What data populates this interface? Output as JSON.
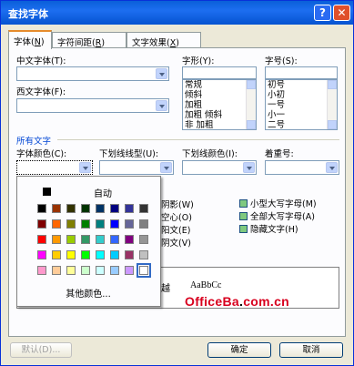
{
  "window": {
    "title": "查找字体",
    "help_label": "?",
    "close_label": "✕"
  },
  "tabs": [
    {
      "label": "字体",
      "key": "N"
    },
    {
      "label": "字符间距",
      "key": "R"
    },
    {
      "label": "文字效果",
      "key": "X"
    }
  ],
  "font": {
    "chinese_label": "中文字体(T):",
    "western_label": "西文字体(F):",
    "style_label": "字形(Y):",
    "size_label": "字号(S):",
    "style_items": [
      "常规",
      "倾斜",
      "加粗",
      "加粗 倾斜",
      "非 加粗"
    ],
    "size_items": [
      "初号",
      "小初",
      "一号",
      "小一",
      "二号"
    ]
  },
  "all_text": {
    "group_title": "所有文字",
    "font_color_label": "字体颜色(C):",
    "underline_type_label": "下划线线型(U):",
    "underline_color_label": "下划线颜色(I):",
    "emphasis_label": "着重号:"
  },
  "color_popup": {
    "auto_label": "自动",
    "more_label": "其他颜色...",
    "swatches": [
      "#000000",
      "#993300",
      "#333300",
      "#003300",
      "#003366",
      "#000080",
      "#333399",
      "#333333",
      "#800000",
      "#ff6600",
      "#808000",
      "#008000",
      "#008080",
      "#0000ff",
      "#666699",
      "#808080",
      "#ff0000",
      "#ff9900",
      "#99cc00",
      "#339966",
      "#33cccc",
      "#3366ff",
      "#800080",
      "#969696",
      "#ff00ff",
      "#ffcc00",
      "#ffff00",
      "#00ff00",
      "#00ffff",
      "#00ccff",
      "#993366",
      "#c0c0c0",
      "#ff99cc",
      "#ffcc99",
      "#ffff99",
      "#ccffcc",
      "#ccffff",
      "#99ccff",
      "#cc99ff",
      "#ffffff"
    ]
  },
  "effects_left_partial": [
    "阴影(W)",
    "空心(O)",
    "阳文(E)",
    "阴文(V)"
  ],
  "effects_left_partial_display": [
    "阴影",
    "空心",
    "阳文",
    "阴文"
  ],
  "effects_left_keys": [
    "(W)",
    "(O)",
    "(E)",
    "(V)"
  ],
  "effects_right": [
    "小型大写字母(M)",
    "全部大写字母(A)",
    "隐藏文字(H)"
  ],
  "preview": {
    "partial_text": "越",
    "sample": "AaBbCc"
  },
  "watermark": {
    "brand": "OfficeBa",
    "dot": ".",
    "tld": "com.cn"
  },
  "footer": {
    "default_label": "默认(D)...",
    "ok_label": "确定",
    "cancel_label": "取消"
  }
}
